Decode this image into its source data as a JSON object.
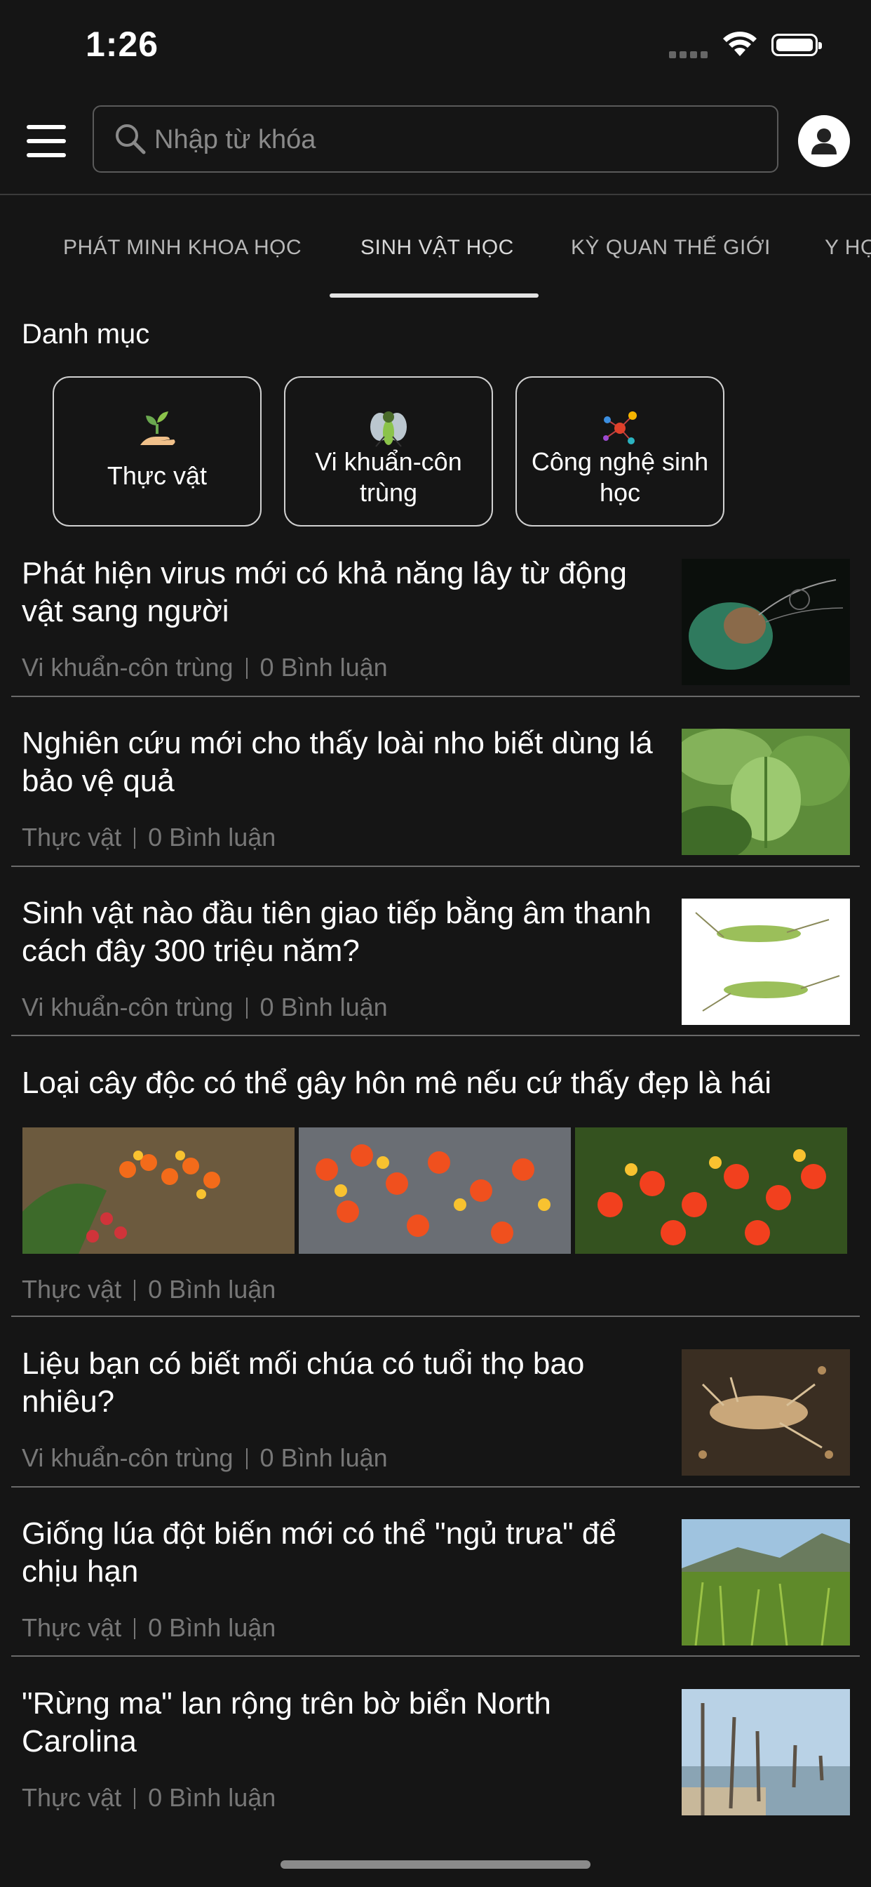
{
  "status_bar": {
    "time": "1:26"
  },
  "header": {
    "search_placeholder": "Nhập từ khóa"
  },
  "tabs": [
    {
      "label": "PHÁT MINH KHOA HỌC"
    },
    {
      "label": "SINH VẬT HỌC",
      "active": true
    },
    {
      "label": "KỲ QUAN THẾ GIỚI"
    },
    {
      "label": "Y HỌ"
    }
  ],
  "categories": {
    "heading": "Danh mục",
    "items": [
      {
        "label": "Thực vật",
        "icon": "sprout-icon"
      },
      {
        "label": "Vi khuẩn-côn trùng",
        "icon": "fly-icon"
      },
      {
        "label": "Công nghệ sinh học",
        "icon": "molecule-icon"
      }
    ]
  },
  "articles": [
    {
      "title": "Phát hiện virus mới có khả năng lây từ động vật sang người",
      "category": "Vi khuẩn-côn trùng",
      "comments": "0 Bình luận"
    },
    {
      "title": "Nghiên cứu mới cho thấy loài nho biết dùng lá bảo vệ quả",
      "category": "Thực vật",
      "comments": "0 Bình luận"
    },
    {
      "title": "Sinh vật nào đầu tiên giao tiếp bằng âm thanh cách đây 300 triệu năm?",
      "category": "Vi khuẩn-côn trùng",
      "comments": "0 Bình luận"
    },
    {
      "title": "Loại cây độc có thể gây hôn mê nếu cứ thấy đẹp là hái",
      "category": "Thực vật",
      "comments": "0 Bình luận"
    },
    {
      "title": "Liệu bạn có biết mối chúa có tuổi thọ bao nhiêu?",
      "category": "Vi khuẩn-côn trùng",
      "comments": "0 Bình luận"
    },
    {
      "title": "Giống lúa đột biến mới có thể \"ngủ trưa\" để chịu hạn",
      "category": "Thực vật",
      "comments": "0 Bình luận"
    },
    {
      "title": "\"Rừng ma\" lan rộng trên bờ biển North Carolina",
      "category": "Thực vật",
      "comments": "0 Bình luận"
    }
  ]
}
